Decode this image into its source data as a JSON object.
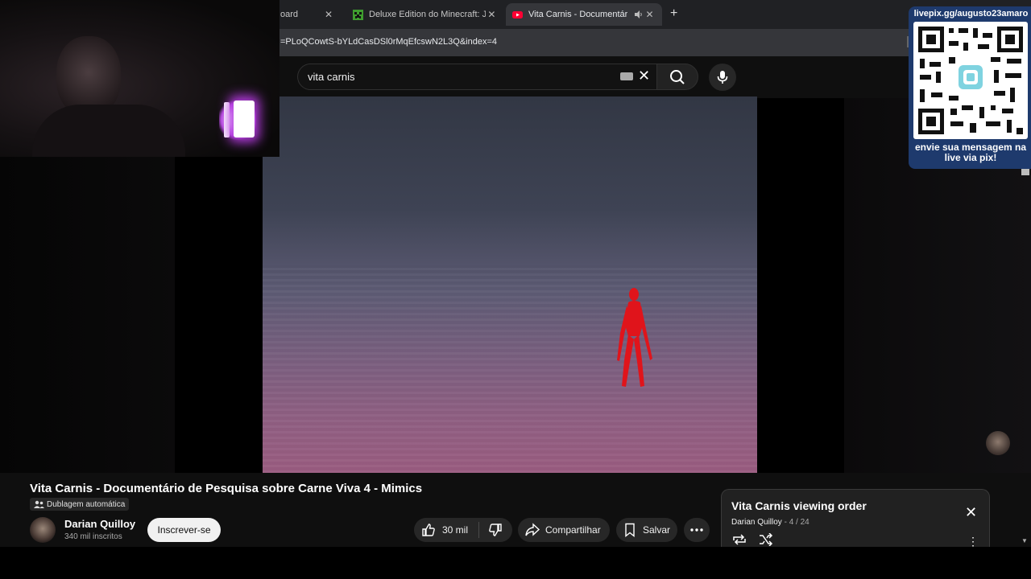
{
  "tabs": [
    {
      "title": "oard",
      "close": "✕",
      "active": false
    },
    {
      "title": "Deluxe Edition do Minecraft: Ja",
      "close": "✕",
      "active": false,
      "favicon": "minecraft-icon"
    },
    {
      "title": "Vita Carnis - Documentário",
      "close": "✕",
      "active": true,
      "favicon": "youtube-icon",
      "audio": "speaker-icon"
    }
  ],
  "new_tab": "+",
  "address": {
    "url": "=PLoQCowtS-bYLdCasDSl0rMqEfcswN2L3Q&index=4"
  },
  "search": {
    "query": "vita carnis",
    "clear": "✕"
  },
  "overlay": {
    "qr_title": "livepix.gg/augusto23amaro",
    "qr_message": "envie sua mensagem na live via pix!"
  },
  "video": {
    "title": "Vita Carnis - Documentário de Pesquisa sobre Carne Viva 4 - Mimics",
    "dub_label": "Dublagem automática"
  },
  "channel": {
    "name": "Darian Quilloy",
    "subscribers": "340 mil inscritos",
    "subscribe_label": "Inscrever-se"
  },
  "actions": {
    "likes": "30 mil",
    "share_label": "Compartilhar",
    "save_label": "Salvar"
  },
  "playlist": {
    "title": "Vita Carnis viewing order",
    "owner": "Darian Quilloy",
    "position": "4 / 24",
    "separator": " - ",
    "close": "✕"
  },
  "colors": {
    "youtube_red": "#ff0033",
    "minecraft_green": "#3f9d2f",
    "qr_panel": "#1e3a6d",
    "figure_red": "#e0141b"
  }
}
